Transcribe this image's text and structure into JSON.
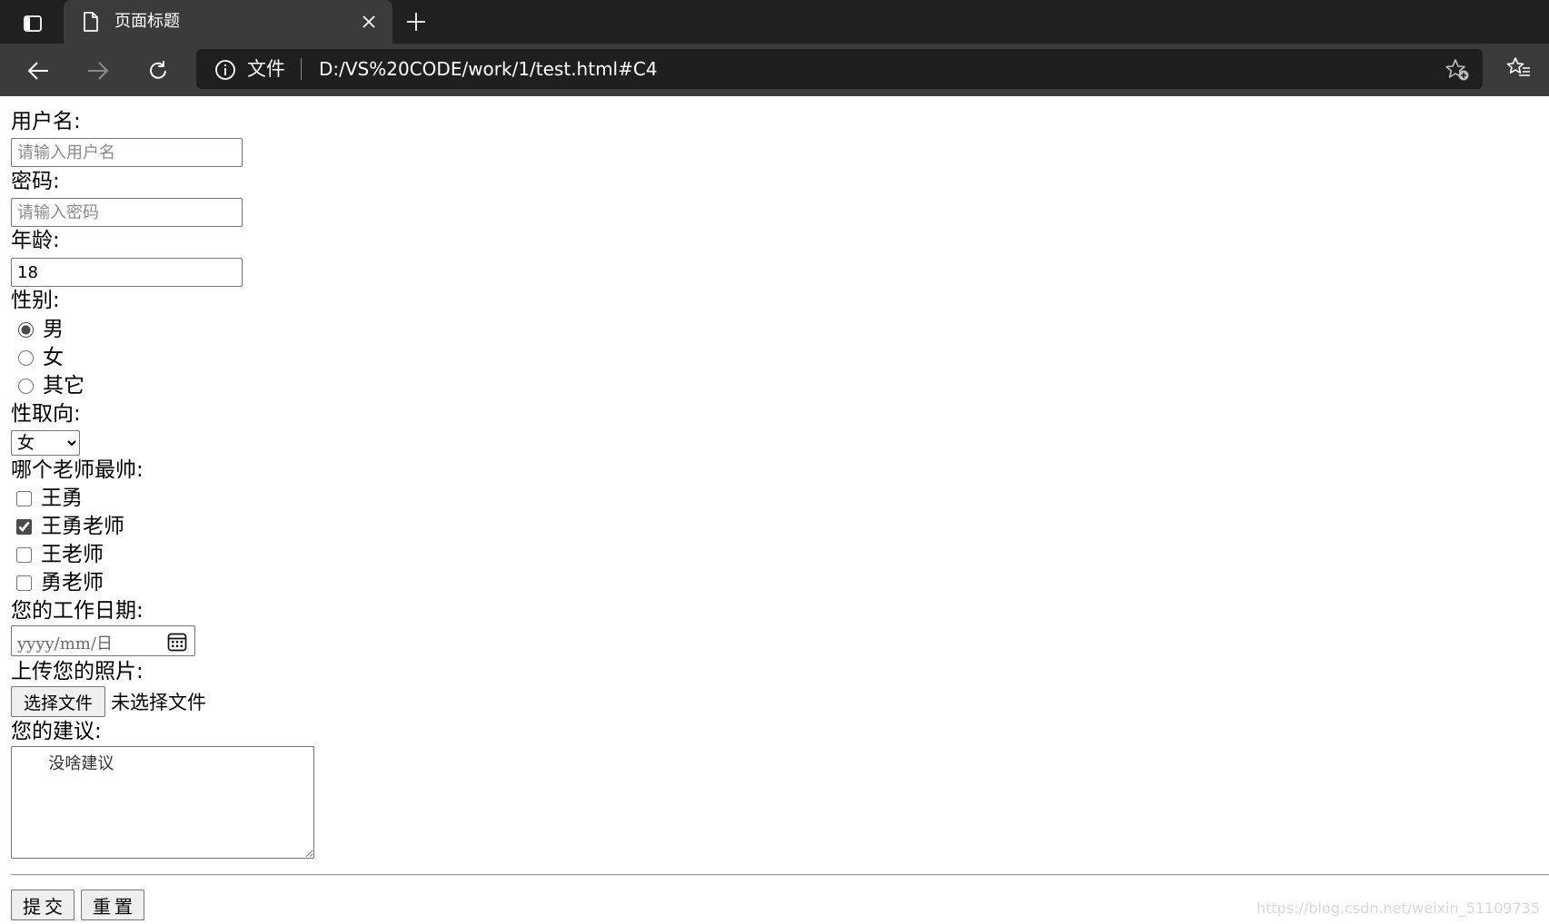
{
  "browser": {
    "tab_title": "页面标题",
    "address_scheme_label": "文件",
    "url": "D:/VS%20CODE/work/1/test.html#C4"
  },
  "form": {
    "username": {
      "label": "用户名:",
      "placeholder": "请输入用户名",
      "value": ""
    },
    "password": {
      "label": "密码:",
      "placeholder": "请输入密码",
      "value": ""
    },
    "age": {
      "label": "年龄:",
      "value": "18"
    },
    "gender": {
      "label": "性别:",
      "options": [
        {
          "label": "男",
          "checked": true
        },
        {
          "label": "女",
          "checked": false
        },
        {
          "label": "其它",
          "checked": false
        }
      ]
    },
    "orientation": {
      "label": "性取向:",
      "selected": "女"
    },
    "teachers": {
      "label": "哪个老师最帅:",
      "options": [
        {
          "label": "王勇",
          "checked": false
        },
        {
          "label": "王勇老师",
          "checked": true
        },
        {
          "label": "王老师",
          "checked": false
        },
        {
          "label": "勇老师",
          "checked": false
        }
      ]
    },
    "work_date": {
      "label": "您的工作日期:",
      "placeholder": "yyyy/mm/日"
    },
    "photo": {
      "label": "上传您的照片:",
      "button_label": "选择文件",
      "status": "未选择文件"
    },
    "suggestion": {
      "label": "您的建议:",
      "value": "      没啥建议"
    },
    "submit_label": "提交",
    "reset_label": "重置"
  },
  "watermark": "https://blog.csdn.net/weixin_51109735"
}
